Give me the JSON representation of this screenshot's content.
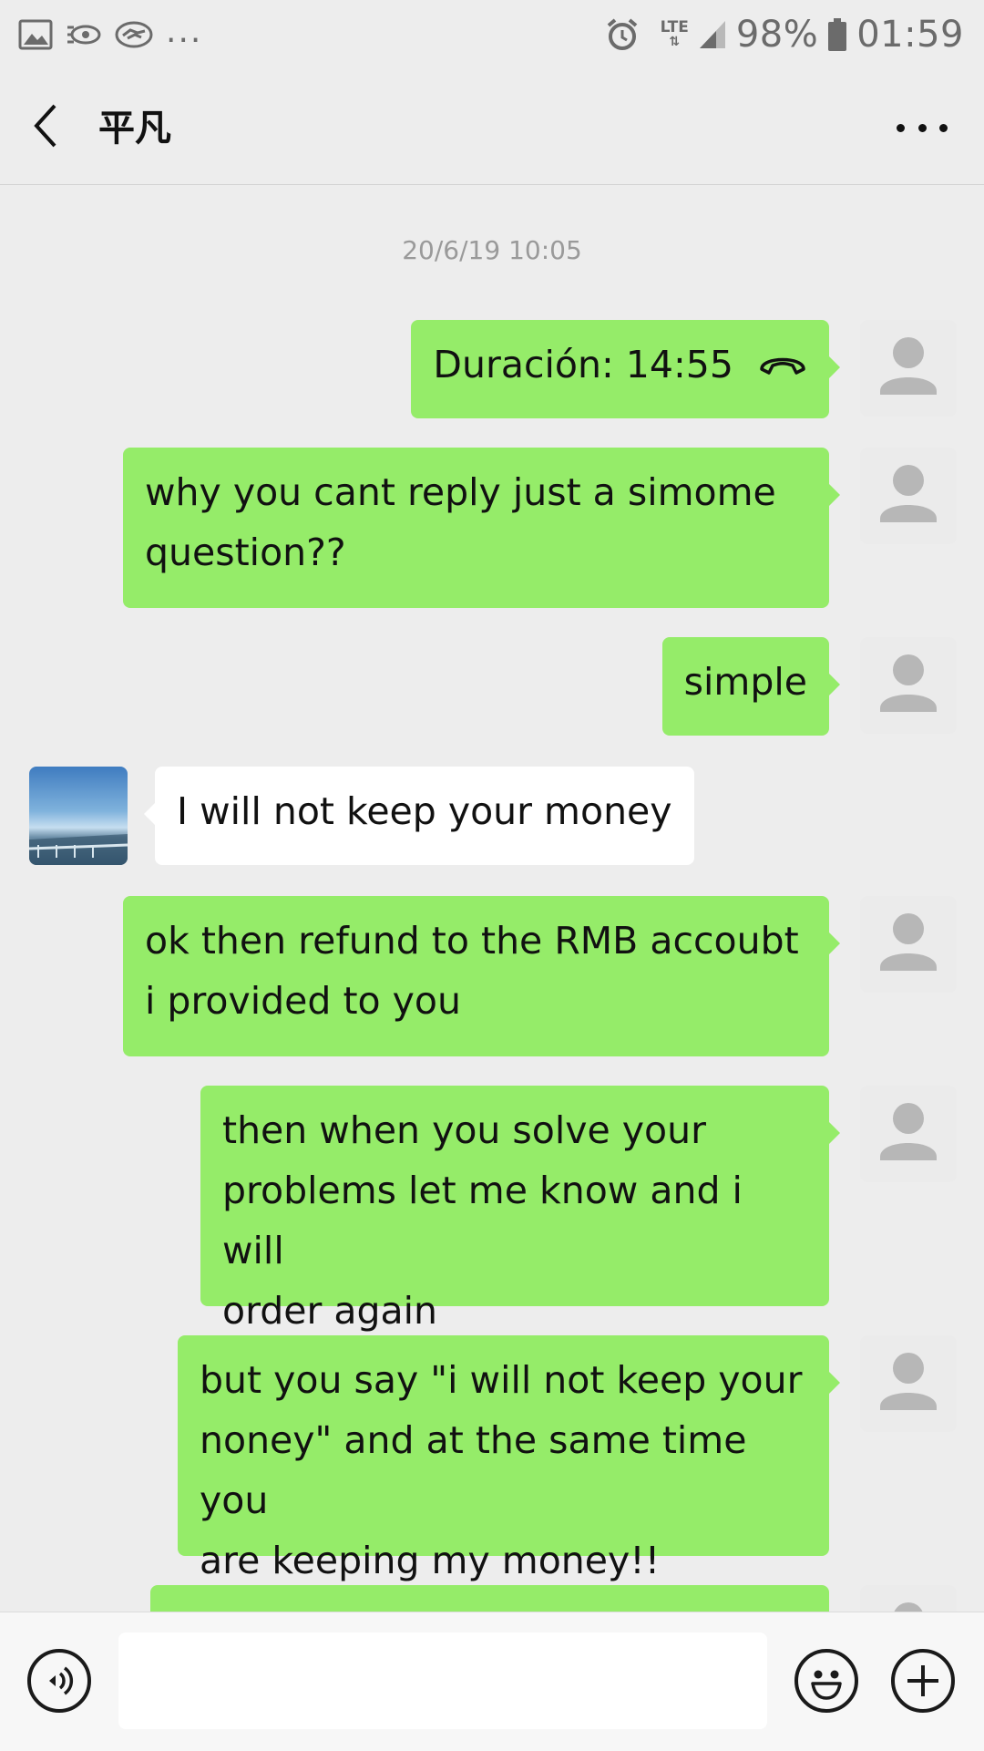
{
  "status_bar": {
    "notification_icons": [
      "gallery-icon",
      "eye-icon",
      "handshake-icon"
    ],
    "more_indicator": "...",
    "network": "LTE",
    "battery": "98%",
    "time": "01:59"
  },
  "header": {
    "title": "平凡"
  },
  "chat": {
    "timestamp": "20/6/19 10:05",
    "messages": [
      {
        "direction": "out",
        "lines": [
          "Duración: 14:55"
        ],
        "type": "call"
      },
      {
        "direction": "out",
        "lines": [
          "why you cant reply just a simome",
          "question??"
        ]
      },
      {
        "direction": "out",
        "lines": [
          "simple"
        ]
      },
      {
        "direction": "in",
        "lines": [
          "I will not keep your money"
        ]
      },
      {
        "direction": "out",
        "lines": [
          "ok then refund to the RMB accoubt",
          "i provided to you"
        ]
      },
      {
        "direction": "out",
        "lines": [
          "then when you solve your",
          "problems let me know and i will",
          "order again"
        ]
      },
      {
        "direction": "out",
        "lines": [
          "but you say \"i will not keep your",
          "noney\" and at the same time you",
          "are keeping my money!!"
        ]
      }
    ]
  },
  "input_bar": {
    "text_value": "",
    "icons": [
      "voice-icon",
      "emoji-icon",
      "plus-icon"
    ]
  },
  "colors": {
    "outgoing_bubble": "#95ec69",
    "incoming_bubble": "#ffffff",
    "background": "#ededed"
  }
}
